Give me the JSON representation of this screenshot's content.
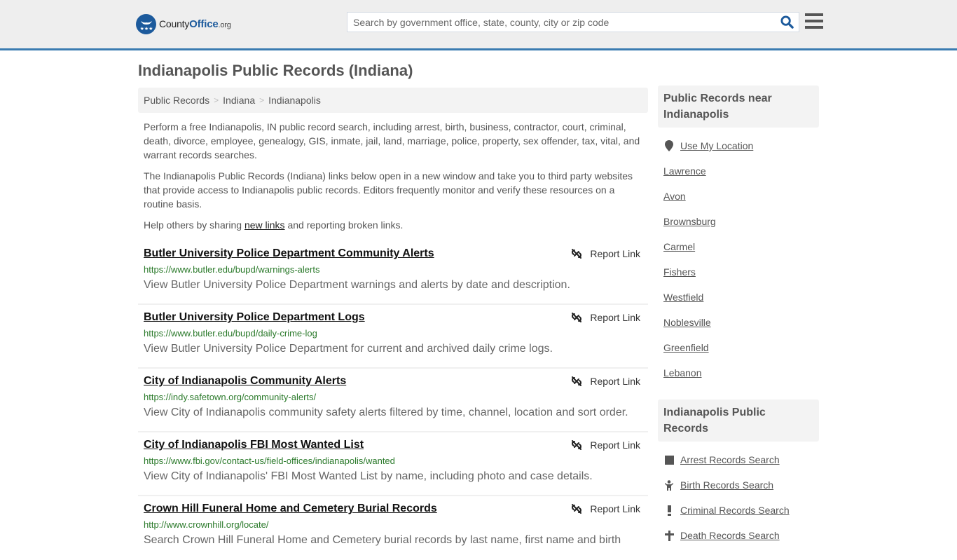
{
  "header": {
    "logo": {
      "text_main": "County",
      "text_accent": "Office",
      "text_suffix": ".org"
    },
    "search": {
      "placeholder": "Search by government office, state, county, city or zip code",
      "value": ""
    },
    "colors": {
      "brand": "#1c5a9c",
      "border": "#3a7bb0"
    }
  },
  "page": {
    "title": "Indianapolis Public Records (Indiana)",
    "breadcrumb": [
      "Public Records",
      "Indiana",
      "Indianapolis"
    ],
    "intro": {
      "p1": "Perform a free Indianapolis, IN public record search, including arrest, birth, business, contractor, court, criminal, death, divorce, employee, genealogy, GIS, inmate, jail, land, marriage, police, property, sex offender, tax, vital, and warrant records searches.",
      "p2": "The Indianapolis Public Records (Indiana) links below open in a new window and take you to third party websites that provide access to Indianapolis public records. Editors frequently monitor and verify these resources on a routine basis.",
      "p3_before": "Help others by sharing ",
      "p3_link": "new links",
      "p3_after": " and reporting broken links."
    }
  },
  "records": [
    {
      "title": "Butler University Police Department Community Alerts",
      "url": "https://www.butler.edu/bupd/warnings-alerts",
      "description": "View Butler University Police Department warnings and alerts by date and description.",
      "report_label": "Report Link"
    },
    {
      "title": "Butler University Police Department Logs",
      "url": "https://www.butler.edu/bupd/daily-crime-log",
      "description": "View Butler University Police Department for current and archived daily crime logs.",
      "report_label": "Report Link"
    },
    {
      "title": "City of Indianapolis Community Alerts",
      "url": "https://indy.safetown.org/community-alerts/",
      "description": "View City of Indianapolis community safety alerts filtered by time, channel, location and sort order.",
      "report_label": "Report Link"
    },
    {
      "title": "City of Indianapolis FBI Most Wanted List",
      "url": "https://www.fbi.gov/contact-us/field-offices/indianapolis/wanted",
      "description": "View City of Indianapolis' FBI Most Wanted List by name, including photo and case details.",
      "report_label": "Report Link"
    },
    {
      "title": "Crown Hill Funeral Home and Cemetery Burial Records",
      "url": "http://www.crownhill.org/locate/",
      "description": "Search Crown Hill Funeral Home and Cemetery burial records by last name, first name and birth",
      "report_label": "Report Link"
    }
  ],
  "sidebar": {
    "nearby": {
      "title": "Public Records near Indianapolis",
      "use_location": "Use My Location",
      "cities": [
        "Lawrence",
        "Avon",
        "Brownsburg",
        "Carmel",
        "Fishers",
        "Westfield",
        "Noblesville",
        "Greenfield",
        "Lebanon"
      ]
    },
    "records": {
      "title": "Indianapolis Public Records",
      "items": [
        {
          "label": "Arrest Records Search",
          "icon": "square-icon"
        },
        {
          "label": "Birth Records Search",
          "icon": "baby-icon"
        },
        {
          "label": "Criminal Records Search",
          "icon": "exclamation-icon"
        },
        {
          "label": "Death Records Search",
          "icon": "cross-icon"
        }
      ]
    }
  }
}
